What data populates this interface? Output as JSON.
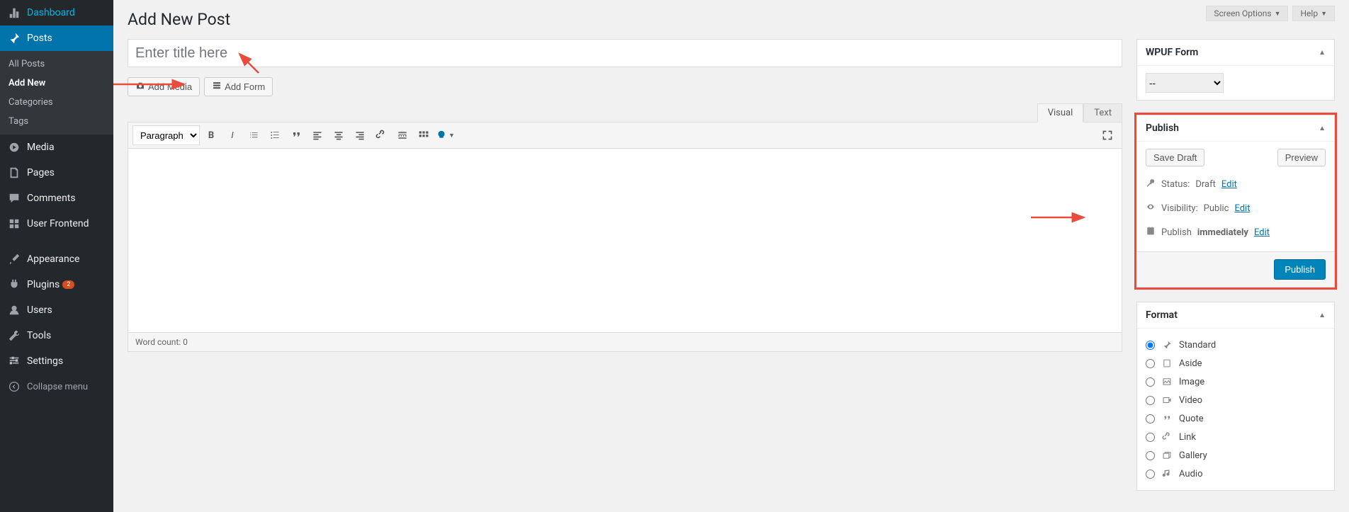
{
  "top": {
    "screen_options": "Screen Options",
    "help": "Help"
  },
  "page": {
    "title": "Add New Post",
    "title_placeholder": "Enter title here"
  },
  "sidebar": {
    "items": [
      {
        "label": "Dashboard"
      },
      {
        "label": "Posts"
      },
      {
        "label": "Media"
      },
      {
        "label": "Pages"
      },
      {
        "label": "Comments"
      },
      {
        "label": "User Frontend"
      },
      {
        "label": "Appearance"
      },
      {
        "label": "Plugins",
        "badge": "2"
      },
      {
        "label": "Users"
      },
      {
        "label": "Tools"
      },
      {
        "label": "Settings"
      }
    ],
    "submenu": [
      "All Posts",
      "Add New",
      "Categories",
      "Tags"
    ],
    "collapse": "Collapse menu"
  },
  "editor": {
    "add_media": "Add Media",
    "add_form": "Add Form",
    "tab_visual": "Visual",
    "tab_text": "Text",
    "format_select": "Paragraph",
    "word_count_label": "Word count: 0"
  },
  "wpuf": {
    "title": "WPUF Form",
    "selected": "--"
  },
  "publish": {
    "title": "Publish",
    "save_draft": "Save Draft",
    "preview": "Preview",
    "status_label": "Status:",
    "status_value": "Draft",
    "edit": "Edit",
    "visibility_label": "Visibility:",
    "visibility_value": "Public",
    "publish_label": "Publish",
    "publish_value": "immediately",
    "button": "Publish"
  },
  "format": {
    "title": "Format",
    "options": [
      "Standard",
      "Aside",
      "Image",
      "Video",
      "Quote",
      "Link",
      "Gallery",
      "Audio"
    ]
  }
}
